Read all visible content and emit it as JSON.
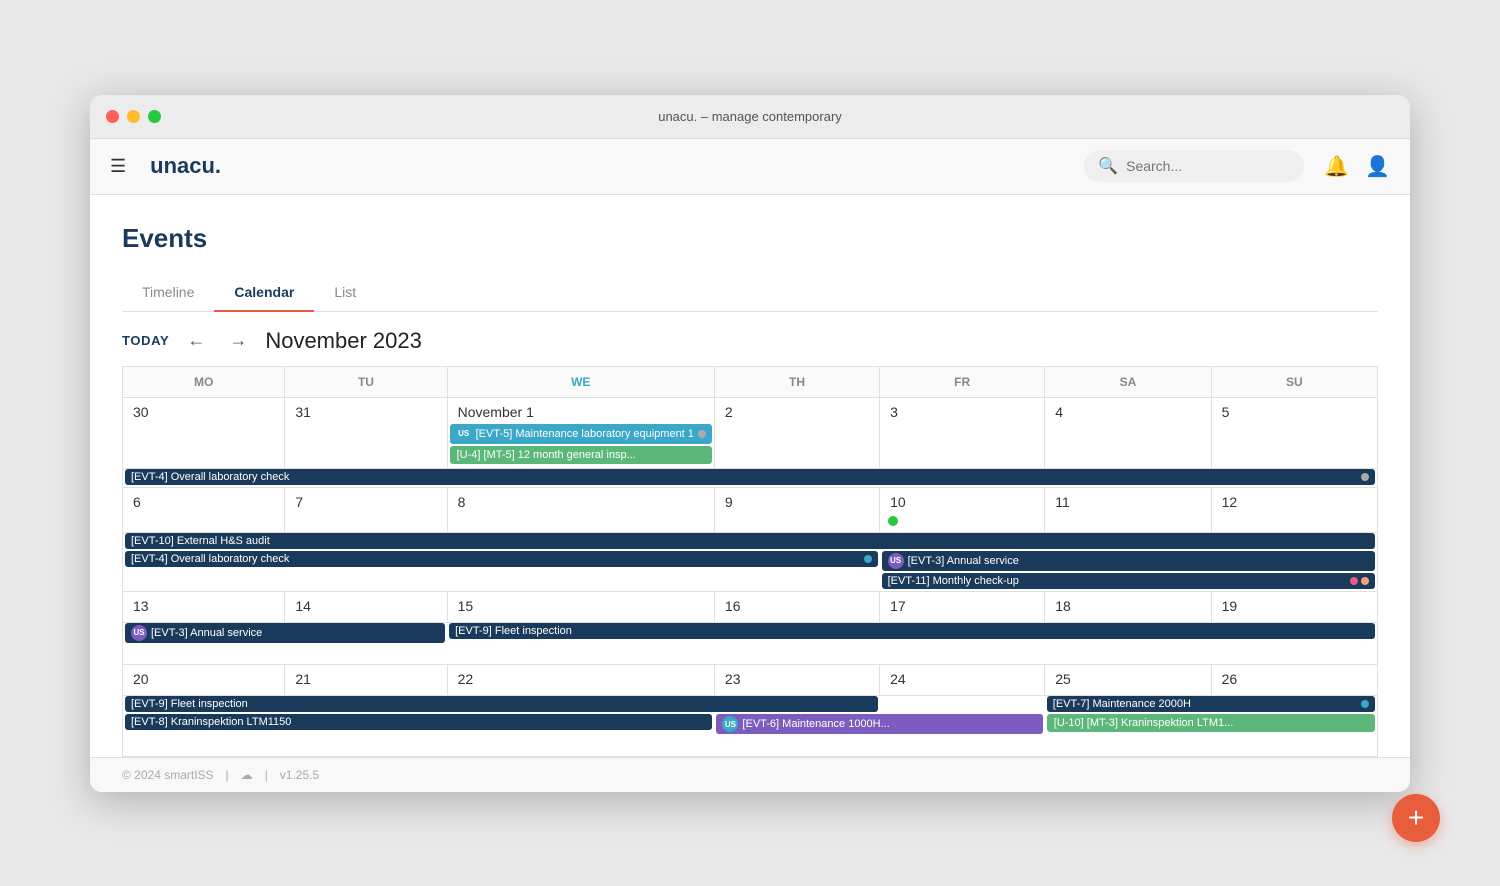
{
  "window": {
    "title": "unacu. – manage contemporary"
  },
  "topnav": {
    "logo": "unacu.",
    "search_placeholder": "Search..."
  },
  "page": {
    "title": "Events"
  },
  "tabs": [
    {
      "label": "Timeline",
      "active": false
    },
    {
      "label": "Calendar",
      "active": true
    },
    {
      "label": "List",
      "active": false
    }
  ],
  "calendar": {
    "month_label": "November 2023",
    "today_btn": "TODAY",
    "weekdays": [
      {
        "label": "MO",
        "today": false
      },
      {
        "label": "TU",
        "today": false
      },
      {
        "label": "WE",
        "today": true
      },
      {
        "label": "TH",
        "today": false
      },
      {
        "label": "FR",
        "today": false
      },
      {
        "label": "SA",
        "today": false
      },
      {
        "label": "SU",
        "today": false
      }
    ]
  },
  "footer": {
    "copyright": "© 2024 smartISS",
    "version": "v1.25.5"
  },
  "fab_label": "+"
}
